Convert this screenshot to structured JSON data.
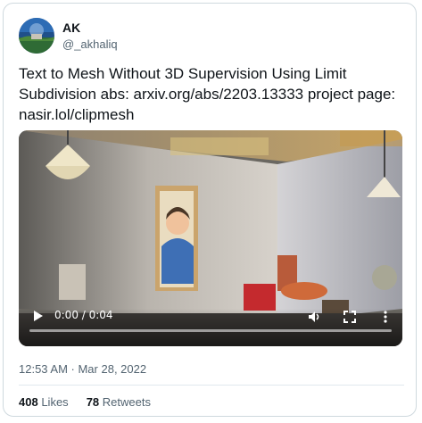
{
  "author": {
    "name": "AK",
    "handle": "@_akhaliq"
  },
  "tweet": {
    "text": "Text to Mesh Without 3D Supervision Using Limit Subdivision abs: arxiv.org/abs/2203.13333 project page: nasir.lol/clipmesh"
  },
  "video": {
    "time": "0:00 / 0:04",
    "progress": 0
  },
  "meta": {
    "timestamp": "12:53 AM · Mar 28, 2022"
  },
  "stats": {
    "likes_count": "408",
    "likes_label": "Likes",
    "retweets_count": "78",
    "retweets_label": "Retweets"
  }
}
